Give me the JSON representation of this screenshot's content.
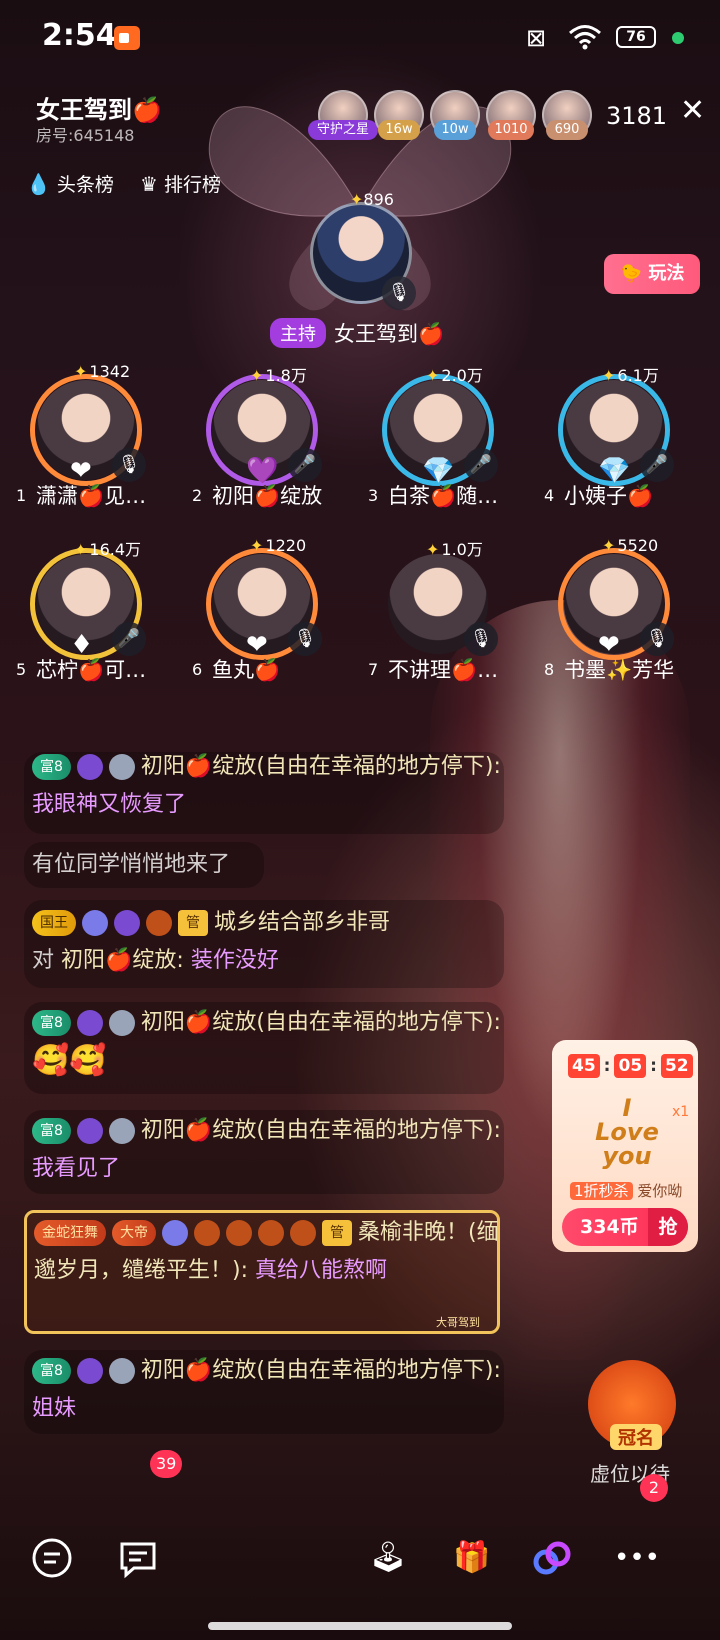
{
  "status_bar": {
    "time": "2:54",
    "battery": "76"
  },
  "room": {
    "title": "女王驾到🍎",
    "room_id": "房号:645148",
    "viewer_count": "3181"
  },
  "top_viewers": [
    {
      "badge": "守护之星",
      "badge_color": "#8a3ad8"
    },
    {
      "badge": "16w",
      "badge_color": "#d4a04a"
    },
    {
      "badge": "10w",
      "badge_color": "#5aa0d8"
    },
    {
      "badge": "1010",
      "badge_color": "#e07a5a"
    },
    {
      "badge": "690",
      "badge_color": "#c99070"
    }
  ],
  "rank_links": {
    "headline": "头条榜",
    "ranking": "排行榜"
  },
  "host": {
    "score": "896",
    "tag": "主持",
    "name": "女王驾到🍎"
  },
  "play_button": "玩法",
  "seats": [
    {
      "num": "1",
      "score": "1342",
      "name": "潇潇🍎见…",
      "ring": "#ff8a3a",
      "mic": "muted"
    },
    {
      "num": "2",
      "score": "1.8万",
      "name": "初阳🍎绽放",
      "ring": "#b05ae8",
      "mic": "on"
    },
    {
      "num": "3",
      "score": "2.0万",
      "name": "白茶🍎随…",
      "ring": "#3ab8e8",
      "mic": "on"
    },
    {
      "num": "4",
      "score": "6.1万",
      "name": "小姨子🍎",
      "ring": "#3ab8e8",
      "mic": "on"
    },
    {
      "num": "5",
      "score": "16.4万",
      "name": "芯柠🍎可…",
      "ring": "#f2c23a",
      "mic": "on"
    },
    {
      "num": "6",
      "score": "1220",
      "name": "鱼丸🍎",
      "ring": "#ff8a3a",
      "mic": "muted"
    },
    {
      "num": "7",
      "score": "1.0万",
      "name": "不讲理🍎…",
      "ring": "#7a5a4a",
      "mic": "muted"
    },
    {
      "num": "8",
      "score": "5520",
      "name": "书墨✨芳华",
      "ring": "#ff8a3a",
      "mic": "muted"
    }
  ],
  "chat": {
    "m1": {
      "badge": "富8",
      "name": "初阳🍎绽放(自由在幸福的地方停下):",
      "text": "我眼神又恢复了"
    },
    "m2": {
      "sys": "有位同学悄悄地来了"
    },
    "m3": {
      "badge_king": "国王",
      "badge_guan": "管",
      "name": "城乡结合部乡非哥",
      "to": "对",
      "target": "初阳🍎绽放:",
      "text": "装作没好"
    },
    "m4": {
      "badge": "富8",
      "name": "初阳🍎绽放(自由在幸福的地方停下):",
      "text": "🥰🥰"
    },
    "m5": {
      "badge": "富8",
      "name": "初阳🍎绽放(自由在幸福的地方停下):",
      "text": "我看见了"
    },
    "m6": {
      "badge_gold": "金蛇狂舞",
      "badge_emperor": "大帝",
      "badge_guan": "管",
      "name": "桑榆非晚！(缅邈岁月，缱绻平生！):",
      "text": "真给八能熬啊",
      "footer": "大哥驾到"
    },
    "m7": {
      "badge": "富8",
      "name": "初阳🍎绽放(自由在幸福的地方停下):",
      "text": "姐妹"
    }
  },
  "promo": {
    "timer": [
      "45",
      "05",
      "52"
    ],
    "art": "I Love you",
    "multiplier": "x1",
    "sale_tag": "1折秒杀",
    "sale_name": "爱你呦",
    "price": "334币",
    "grab": "抢"
  },
  "crown_seat": {
    "label": "冠名",
    "subtitle": "虚位以待"
  },
  "bottom": {
    "message_badge": "39",
    "more_badge": "2"
  }
}
